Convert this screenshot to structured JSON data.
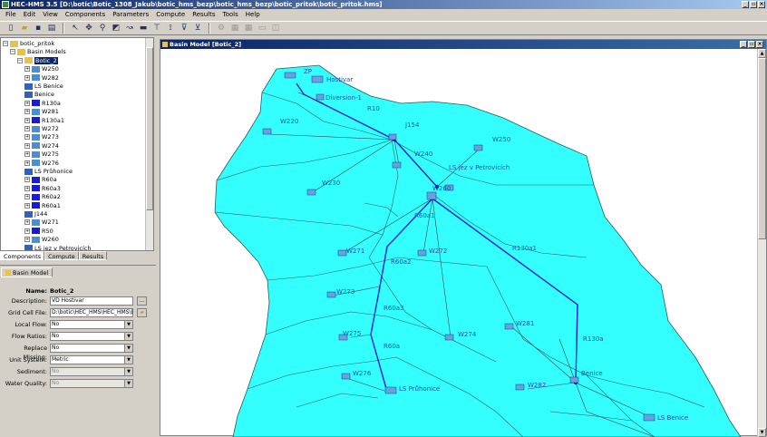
{
  "window": {
    "title": "HEC-HMS 3.5 [D:\\botic\\Botic_1308_Jakub\\botic_hms_bezp\\botic_hms_bezp\\botic_pritok\\botic_pritok.hms]",
    "buttons": [
      "_",
      "▫",
      "×"
    ]
  },
  "menu": [
    "File",
    "Edit",
    "View",
    "Components",
    "Parameters",
    "Compute",
    "Results",
    "Tools",
    "Help"
  ],
  "toolbar": {
    "icons": [
      "new-icon",
      "open-icon",
      "save-icon",
      "print-icon",
      "arrow-icon",
      "move-icon",
      "zoom-icon",
      "subbasin-icon",
      "reach-icon",
      "reservoir-icon",
      "junction-icon",
      "diversion-icon",
      "source-icon",
      "sink-icon",
      "compute-icon",
      "results1-icon",
      "results2-icon",
      "results3-icon",
      "results4-icon"
    ]
  },
  "tree": {
    "items": [
      {
        "label": "botic_pritok",
        "level": 0,
        "icon": "folder"
      },
      {
        "label": "Basin Models",
        "level": 1,
        "icon": "folder"
      },
      {
        "label": "Botic_2",
        "level": 2,
        "icon": "basin",
        "selected": true
      },
      {
        "label": "W250",
        "level": 3,
        "icon": "subbasin"
      },
      {
        "label": "W282",
        "level": 3,
        "icon": "subbasin"
      },
      {
        "label": "LS Benice",
        "level": 3,
        "icon": "junction"
      },
      {
        "label": "Benice",
        "level": 3,
        "icon": "junction"
      },
      {
        "label": "R130a",
        "level": 3,
        "icon": "reach"
      },
      {
        "label": "W281",
        "level": 3,
        "icon": "subbasin"
      },
      {
        "label": "R130a1",
        "level": 3,
        "icon": "reach"
      },
      {
        "label": "W272",
        "level": 3,
        "icon": "subbasin"
      },
      {
        "label": "W273",
        "level": 3,
        "icon": "subbasin"
      },
      {
        "label": "W274",
        "level": 3,
        "icon": "subbasin"
      },
      {
        "label": "W275",
        "level": 3,
        "icon": "subbasin"
      },
      {
        "label": "W276",
        "level": 3,
        "icon": "subbasin"
      },
      {
        "label": "LS Průhonice",
        "level": 3,
        "icon": "junction"
      },
      {
        "label": "R60a",
        "level": 3,
        "icon": "reach"
      },
      {
        "label": "R60a3",
        "level": 3,
        "icon": "reach"
      },
      {
        "label": "R60a2",
        "level": 3,
        "icon": "reach"
      },
      {
        "label": "R60a1",
        "level": 3,
        "icon": "reach"
      },
      {
        "label": "J144",
        "level": 3,
        "icon": "junction"
      },
      {
        "label": "W271",
        "level": 3,
        "icon": "subbasin"
      },
      {
        "label": "R50",
        "level": 3,
        "icon": "reach"
      },
      {
        "label": "W260",
        "level": 3,
        "icon": "subbasin"
      },
      {
        "label": "LS jez v Petrovicích",
        "level": 3,
        "icon": "junction"
      }
    ]
  },
  "tabs": [
    "Components",
    "Compute",
    "Results"
  ],
  "attr_tab": "Basin Model",
  "attributes": {
    "name_label": "Name:",
    "name_value": "Botic_2",
    "fields": [
      {
        "label": "Description:",
        "value": "VD Hostivar",
        "type": "text",
        "side_button": "..."
      },
      {
        "label": "Grid Cell File:",
        "value": "D:\\botic\\HEC_HMS\\HEC_HMS\\Bo",
        "type": "text",
        "side_button": "folder"
      },
      {
        "label": "Local Flow:",
        "value": "No",
        "type": "select"
      },
      {
        "label": "Flow Ratios:",
        "value": "No",
        "type": "select"
      },
      {
        "label": "Replace Missing:",
        "value": "No",
        "type": "select"
      },
      {
        "label": "Unit System:",
        "value": "Metric",
        "type": "select"
      },
      {
        "label": "Sediment:",
        "value": "No",
        "type": "select",
        "disabled": true
      },
      {
        "label": "Water Quality:",
        "value": "No",
        "type": "select",
        "disabled": true
      }
    ]
  },
  "map": {
    "title": "Basin Model [Botic_2]",
    "colors": {
      "basin": "#33ffff",
      "reach": "#1a1adb",
      "link": "#404040"
    },
    "labels": [
      "ZP",
      "Hostivar",
      "Diversion-1",
      "R10",
      "W220",
      "J154",
      "W250",
      "W240",
      "LS jez v Petrovicích",
      "W230",
      "W260",
      "R60a1",
      "W271",
      "W272",
      "R130a1",
      "R60a2",
      "W273",
      "R60a3",
      "W281",
      "W275",
      "W274",
      "R130a",
      "R60a",
      "W276",
      "Benice",
      "W282",
      "LS Průhonice",
      "LS Benice"
    ]
  }
}
